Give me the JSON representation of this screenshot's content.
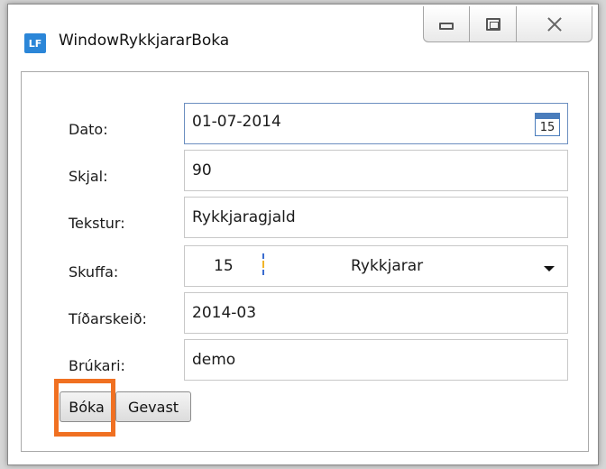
{
  "window": {
    "logo": "LF",
    "title": "WindowRykkjararBoka",
    "caption_buttons": [
      "minimize",
      "maximize",
      "close"
    ]
  },
  "form": {
    "dato": {
      "label": "Dato:",
      "value": "01-07-2014",
      "calendar_day": "15"
    },
    "skjal": {
      "label": "Skjal:",
      "value": "90"
    },
    "tekstur": {
      "label": "Tekstur:",
      "value": "Rykkjaragjald"
    },
    "skuffa": {
      "label": "Skuffa:",
      "number": "15",
      "text": "Rykkjarar"
    },
    "tidarskeid": {
      "label": "Tíðarskeið:",
      "value": "2014-03"
    },
    "brukari": {
      "label": "Brúkari:",
      "value": "demo"
    }
  },
  "buttons": {
    "boka": "Bóka",
    "gevast": "Gevast"
  },
  "colors": {
    "highlight": "#f07021",
    "logo_blue": "#2b86d8"
  }
}
